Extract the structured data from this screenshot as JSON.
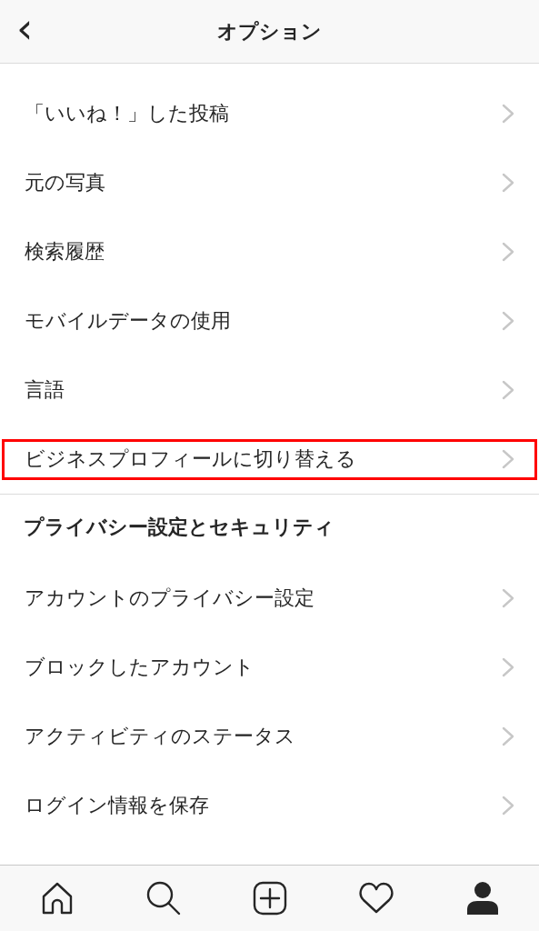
{
  "header": {
    "back": "‹",
    "title": "オプション"
  },
  "sections": [
    {
      "items": [
        {
          "label": "「いいね！」した投稿",
          "highlighted": false
        },
        {
          "label": "元の写真",
          "highlighted": false
        },
        {
          "label": "検索履歴",
          "highlighted": false
        },
        {
          "label": "モバイルデータの使用",
          "highlighted": false
        },
        {
          "label": "言語",
          "highlighted": false
        },
        {
          "label": "ビジネスプロフィールに切り替える",
          "highlighted": true
        }
      ]
    },
    {
      "title": "プライバシー設定とセキュリティ",
      "items": [
        {
          "label": "アカウントのプライバシー設定",
          "highlighted": false
        },
        {
          "label": "ブロックしたアカウント",
          "highlighted": false
        },
        {
          "label": "アクティビティのステータス",
          "highlighted": false
        },
        {
          "label": "ログイン情報を保存",
          "highlighted": false
        }
      ]
    }
  ],
  "tab_bar": [
    {
      "kind": "home",
      "selected": false
    },
    {
      "kind": "search",
      "selected": false
    },
    {
      "kind": "add",
      "selected": false
    },
    {
      "kind": "heart",
      "selected": false
    },
    {
      "kind": "profile",
      "selected": true
    }
  ]
}
